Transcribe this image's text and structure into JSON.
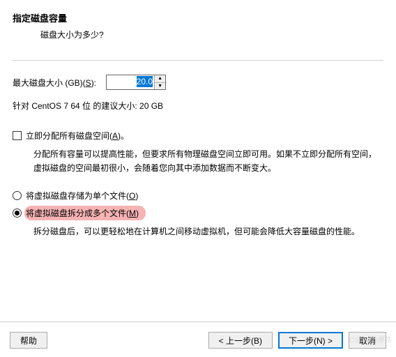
{
  "title": "指定磁盘容量",
  "subtitle": "磁盘大小为多少?",
  "sizeLabel_pre": "最大磁盘大小 (GB)(",
  "sizeLabel_hot": "S",
  "sizeLabel_post": "):",
  "sizeValue": "20.0",
  "recommend": "针对 CentOS 7 64 位 的建议大小: 20 GB",
  "allocate_pre": "立即分配所有磁盘空间(",
  "allocate_hot": "A",
  "allocate_post": ")。",
  "allocate_desc": "分配所有容量可以提高性能，但要求所有物理磁盘空间立即可用。如果不立即分配所有空间，虚拟磁盘的空间最初很小，会随着您向其中添加数据而不断变大。",
  "radio_single_pre": "将虚拟磁盘存储为单个文件(",
  "radio_single_hot": "O",
  "radio_single_post": ")",
  "radio_multi_pre": "将虚拟磁盘拆分成多个文件(",
  "radio_multi_hot": "M",
  "radio_multi_post": ")",
  "radio_desc": "拆分磁盘后，可以更轻松地在计算机之间移动虚拟机，但可能会降低大容量磁盘的性能。",
  "buttons": {
    "help": "帮助",
    "back": "< 上一步(B)",
    "next": "下一步(N) >",
    "cancel": "取消"
  },
  "watermark": "CSDN @廖浩"
}
